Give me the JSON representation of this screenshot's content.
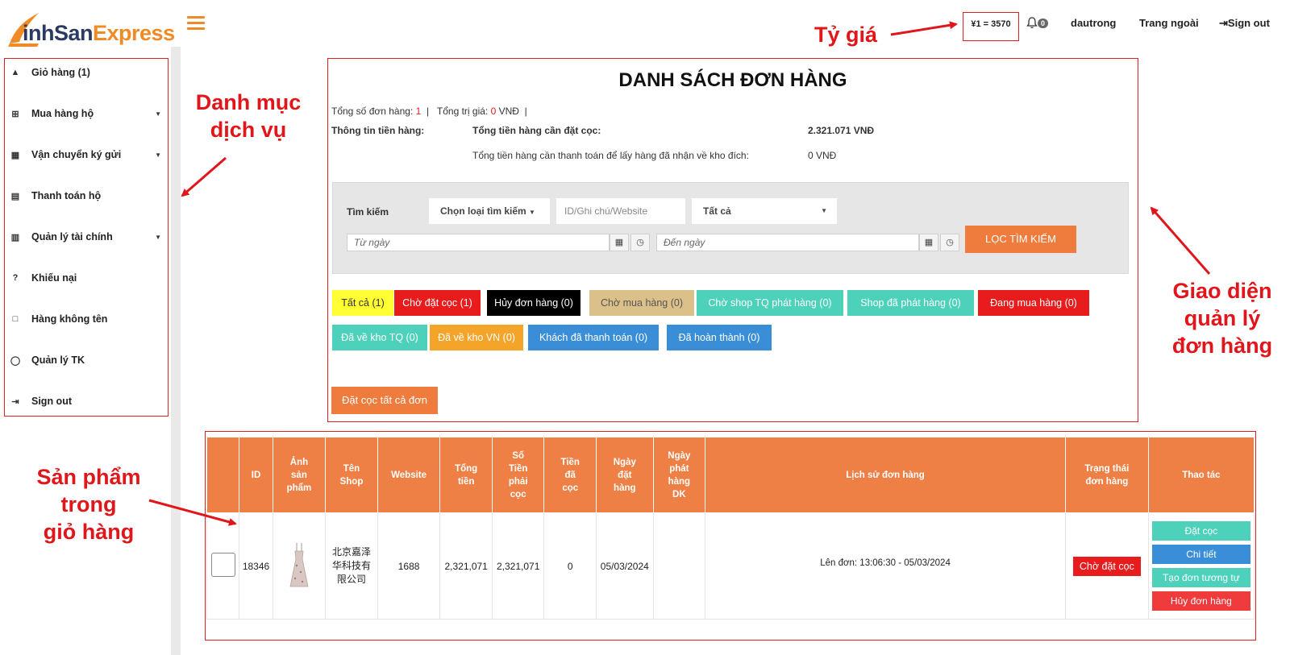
{
  "header": {
    "logo_part1": "inhSan",
    "logo_part2": "Express",
    "rate": "¥1 = 3570",
    "bell_count": "0",
    "username": "dautrong",
    "home_link": "Trang ngoài",
    "signout": "Sign out"
  },
  "sidebar": {
    "items": [
      {
        "label": "Giỏ hàng (1)"
      },
      {
        "label": "Mua hàng hộ"
      },
      {
        "label": "Vận chuyển ký gửi"
      },
      {
        "label": "Thanh toán hộ"
      },
      {
        "label": "Quản lý tài chính"
      },
      {
        "label": "Khiếu nại"
      },
      {
        "label": "Hàng không tên"
      },
      {
        "label": "Quản lý TK"
      },
      {
        "label": "Sign out"
      }
    ]
  },
  "main": {
    "title": "DANH SÁCH ĐƠN HÀNG",
    "summary": {
      "total_orders_label": "Tổng số đơn hàng:",
      "total_orders_value": "1",
      "total_value_label": "Tổng trị giá:",
      "total_value_value": "0",
      "total_value_unit": "VNĐ",
      "money_info_label": "Thông tin tiền hàng:",
      "deposit_label": "Tổng tiền hàng cần đặt cọc:",
      "deposit_value": "2.321.071 VNĐ",
      "pay_label": "Tổng tiền hàng cần thanh toán để lấy hàng đã nhận về kho đích:",
      "pay_value": "0 VNĐ"
    },
    "search": {
      "label": "Tìm kiếm",
      "type_select": "Chọn loại tìm kiếm",
      "id_placeholder": "ID/Ghi chú/Website",
      "status_select": "Tất cả",
      "from_placeholder": "Từ ngày",
      "to_placeholder": "Đến ngày",
      "filter_button": "LỌC TÌM KIẾM"
    },
    "tags": [
      {
        "label": "Tất cả (1)",
        "bg": "#ffff33",
        "fg": "#333333"
      },
      {
        "label": "Chờ đặt cọc (1)",
        "bg": "#e81c1c",
        "fg": "#ffffff"
      },
      {
        "label": "Hủy đơn hàng (0)",
        "bg": "#000000",
        "fg": "#ffffff"
      },
      {
        "label": "Chờ mua hàng (0)",
        "bg": "#dcc08a",
        "fg": "#555555"
      },
      {
        "label": "Chờ shop TQ phát hàng (0)",
        "bg": "#4ed1bb",
        "fg": "#ffffff"
      },
      {
        "label": "Shop đã phát hàng (0)",
        "bg": "#4ed1bb",
        "fg": "#ffffff"
      },
      {
        "label": "Đang mua hàng (0)",
        "bg": "#e81c1c",
        "fg": "#ffffff"
      },
      {
        "label": "Đã về kho TQ (0)",
        "bg": "#4ed1bb",
        "fg": "#ffffff"
      },
      {
        "label": "Đã về kho VN (0)",
        "bg": "#f5a42a",
        "fg": "#ffffff"
      },
      {
        "label": "Khách đã thanh toán (0)",
        "bg": "#3a8ed8",
        "fg": "#ffffff"
      },
      {
        "label": "Đã hoàn thành (0)",
        "bg": "#3a8ed8",
        "fg": "#ffffff"
      }
    ],
    "deposit_all": "Đặt cọc tất cả đơn"
  },
  "table": {
    "headers": [
      "",
      "ID",
      "Ảnh sản phẩm",
      "Tên Shop",
      "Website",
      "Tổng tiền",
      "Số Tiền phải cọc",
      "Tiền đã cọc",
      "Ngày đặt hàng",
      "Ngày phát hàng DK",
      "Lịch sử đơn hàng",
      "Trạng thái đơn hàng",
      "Thao tác"
    ],
    "row": {
      "id": "18346",
      "shop": "北京嘉泽华科技有限公司",
      "website": "1688",
      "total": "2,321,071",
      "deposit_required": "2,321,071",
      "deposited": "0",
      "order_date": "05/03/2024",
      "ship_date": "",
      "history": "Lên đơn: 13:06:30 - 05/03/2024",
      "status": "Chờ đặt cọc",
      "actions": [
        "Đặt cọc",
        "Chi tiết",
        "Tạo đơn tương tự",
        "Hủy đơn hàng"
      ]
    }
  },
  "annotations": {
    "rate": "Tỷ giá",
    "service_menu": "Danh mục\ndịch vụ",
    "order_ui": "Giao diện\nquản lý\nđơn hàng",
    "cart_products": "Sản phẩm\ntrong\ngiỏ hàng"
  },
  "colors": {
    "accent": "#ef7c3c",
    "annotation_red": "#e0161a",
    "action_green": "#4ed1bb",
    "action_blue": "#3a8ed8",
    "action_red": "#ef3b3b"
  }
}
